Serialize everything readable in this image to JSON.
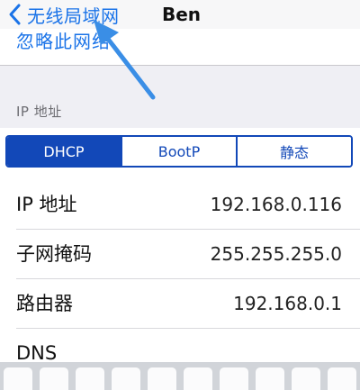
{
  "navbar": {
    "back_label": "无线局域网",
    "title": "Ben"
  },
  "forget_cell": {
    "label": "忽略此网络"
  },
  "section": {
    "header": "IP 地址"
  },
  "segmented": {
    "options": [
      "DHCP",
      "BootP",
      "静态"
    ],
    "selected": "DHCP"
  },
  "rows": [
    {
      "label": "IP 地址",
      "value": "192.168.0.116"
    },
    {
      "label": "子网掩码",
      "value": "255.255.255.0"
    },
    {
      "label": "路由器",
      "value": "192.168.0.1"
    },
    {
      "label": "DNS",
      "value": ""
    }
  ],
  "colors": {
    "accent": "#1a73e8",
    "segment": "#1248b8",
    "arrow": "#3a8ee6",
    "background": "#efeff4"
  },
  "icons": {
    "back": "chevron-left-icon",
    "annotation": "arrow-annotation"
  }
}
